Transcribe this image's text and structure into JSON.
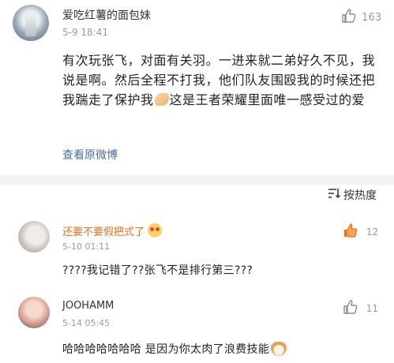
{
  "post": {
    "username": "爱吃红薯的面包妹",
    "time": "5-9 18:41",
    "like_count": "163",
    "content_before": "有次玩张飞，对面有关羽。一进来就二弟好久不见，我说是啊。然后全程不打我，他们队友围殴我的时候还把我踹走了保护我",
    "content_after": "这是王者荣耀里面唯一感受过的爱",
    "view_original": "查看原微博"
  },
  "sort": {
    "label": "按热度"
  },
  "comments": [
    {
      "username": "还要不要假把式了",
      "time": "5-10 01:11",
      "like_count": "12",
      "text": "????我记错了??张飞不是排行第三???"
    },
    {
      "username": "JOOHAMM",
      "time": "5-14 05:45",
      "like_count": "11",
      "text": "哈哈哈哈哈哈哈 是因为你太肉了浪费技能"
    }
  ],
  "colors": {
    "link": "#4a6e9b",
    "orange_name": "#e8711a",
    "liked_thumb": "#e8711a",
    "muted": "#9a9a9a",
    "divider": "#f2f2f2"
  },
  "icons": {
    "like": "thumb-up-icon",
    "sort": "sort-lines-icon"
  }
}
